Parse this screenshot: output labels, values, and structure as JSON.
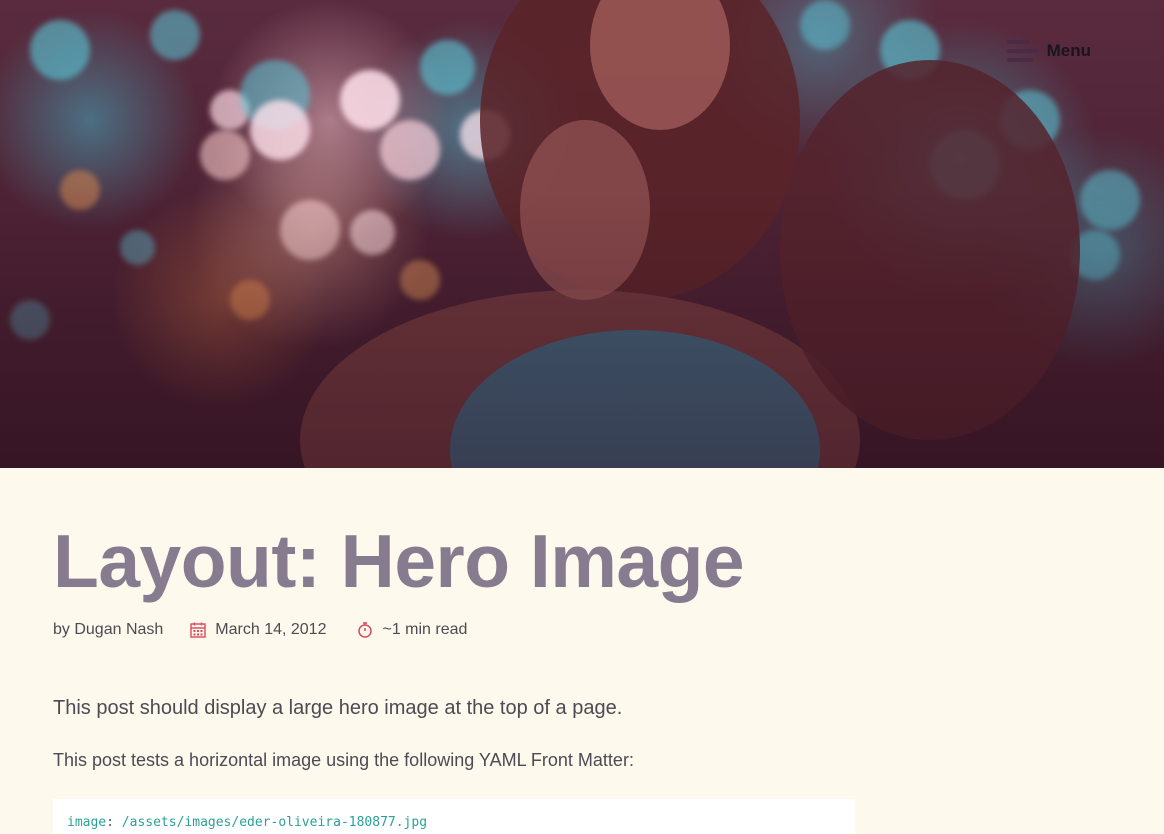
{
  "header": {
    "menu_label": "Menu"
  },
  "post": {
    "title": "Layout: Hero Image",
    "author": "by Dugan Nash",
    "date": "March 14, 2012",
    "read_time": "~1 min read",
    "lead": "This post should display a large hero image at the top of a page.",
    "paragraph": "This post tests a horizontal image using the following YAML Front Matter:",
    "code": {
      "key": "image",
      "separator": ":",
      "value": "/assets/images/eder-oliveira-180877.jpg"
    }
  },
  "icons": {
    "menu": "hamburger-icon",
    "date": "calendar-icon",
    "read_time": "stopwatch-icon"
  },
  "colors": {
    "background": "#fdf9ec",
    "title": "#867b8f",
    "text": "#4e4a54",
    "icon_accent": "#d9485f",
    "code": "#2aa198"
  }
}
